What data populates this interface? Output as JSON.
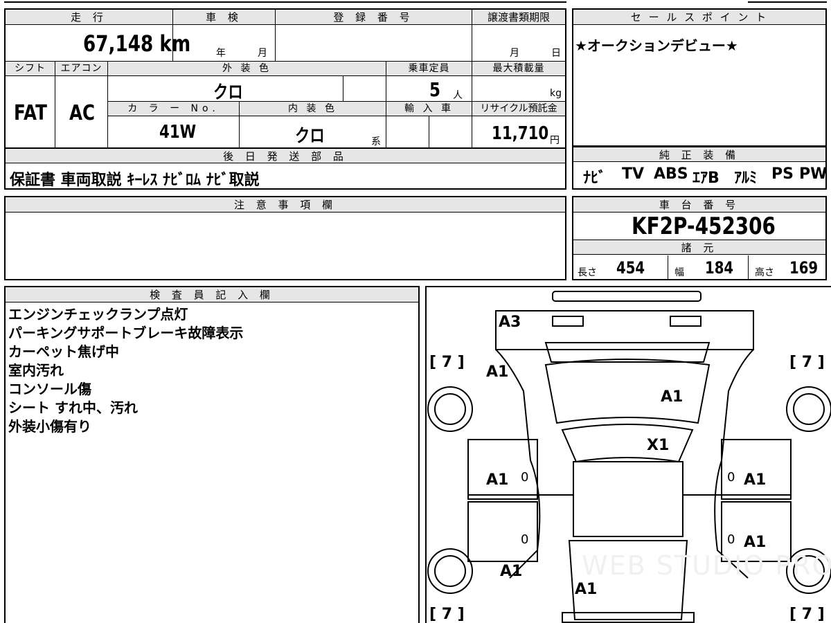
{
  "top_info": {
    "headers": {
      "mileage": "走 行",
      "inspection": "車 検",
      "registration": "登 録 番 号",
      "transfer_deadline": "譲渡書類期限",
      "shift": "シフト",
      "aircon": "エアコン",
      "exterior_color": "外 装 色",
      "capacity": "乗車定員",
      "max_load": "最大積載量",
      "color_no": "カ ラ ー No.",
      "interior_color": "内 装 色",
      "import": "輸 入 車",
      "recycle_fee": "リサイクル預託金",
      "later_parts": "後 日 発 送 部 品",
      "notes": "注 意 事 項 欄",
      "inspector": "検 査 員 記 入 欄"
    },
    "mileage": "67,148 km",
    "inspection_year_unit": "年",
    "inspection_month_unit": "月",
    "deadline_month_unit": "月",
    "deadline_day_unit": "日",
    "shift": "FAT",
    "aircon": "AC",
    "exterior_color": "クロ",
    "capacity": "5",
    "capacity_unit": "人",
    "max_load_unit": "kg",
    "color_no": "41W",
    "interior_color": "クロ",
    "interior_suffix": "系",
    "recycle_fee": "11,710",
    "recycle_unit": "円",
    "later_parts": "保証書 車両取説 ｷｰﾚｽ ﾅﾋﾞﾛﾑ ﾅﾋﾞ取説"
  },
  "sales_point": {
    "header": "セ ー ル ス ポ イ ン ト",
    "text": "★オークションデビュー★"
  },
  "genuine_equipment": {
    "header": "純 正 装 備",
    "items": [
      "ﾅﾋﾞ",
      "TV",
      "ABS",
      "ｴｱB",
      "ｱﾙﾐ",
      "PS",
      "PW"
    ]
  },
  "chassis": {
    "header": "車 台 番 号",
    "number": "KF2P-452306"
  },
  "specs": {
    "header": "諸 元",
    "length_label": "長さ",
    "length": "454",
    "width_label": "幅",
    "width": "184",
    "height_label": "高さ",
    "height": "169"
  },
  "inspector_notes": [
    "エンジンチェックランプ点灯",
    "パーキングサポートブレーキ故障表示",
    "カーペット焦げ中",
    "室内汚れ",
    "コンソール傷",
    "シート すれ中、汚れ",
    "外装小傷有り"
  ],
  "diagram": {
    "bracket_7": "[ 7 ]",
    "marks": {
      "rear_roof": "A3",
      "front_left_fender": "A1",
      "hood": "A1",
      "windshield": "X1",
      "left_front_door": "A1",
      "right_front_door": "A1",
      "right_rear_door": "A1",
      "left_rear_quarter": "A1",
      "rear_center": "A1",
      "zero": "0"
    },
    "watermark": "WEB STUDIO PRO"
  }
}
